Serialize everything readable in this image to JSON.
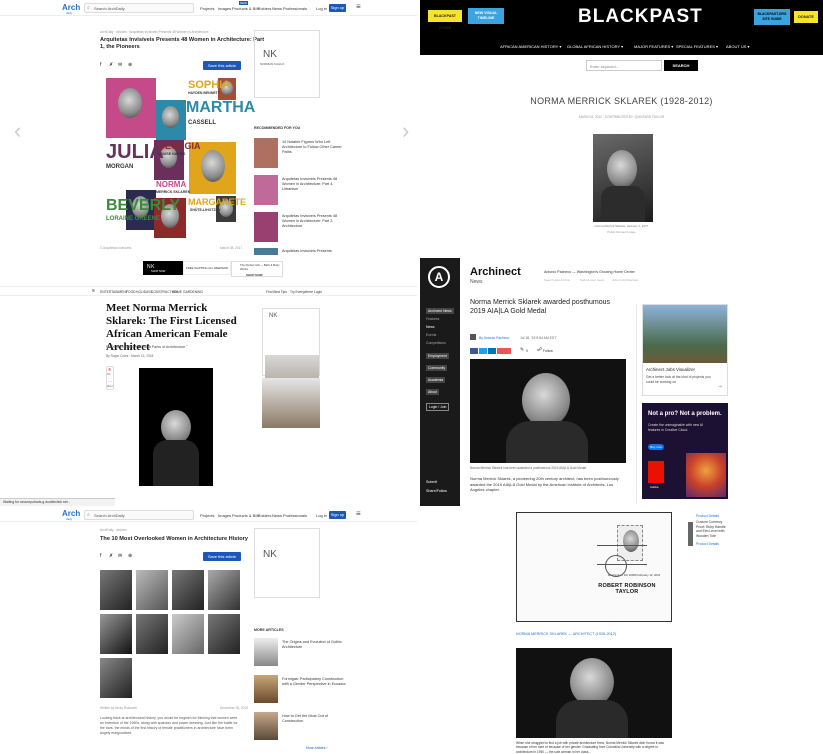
{
  "p1": {
    "logo": "Arch",
    "logo_sub": "daily",
    "search_placeholder": "Search ArchDaily",
    "nav": [
      "Projects",
      "Images",
      "Products & BIM",
      "Folders",
      "News",
      "Professionals"
    ],
    "nav_badge": "NEW",
    "login": "Log in",
    "signup": "Sign up",
    "breadcrumb": "ArchDaily · Articles · Arquitetas Invisíveis Presents 48 Women in Architecture",
    "title": "Arquitetas Invisíveis Presents 48 Women in Architecture: Part 1, the Pioneers",
    "save_label": "Save this article",
    "names": [
      "SOPHIA",
      "HAYDEN BENNETT",
      "MARTHA",
      "CASSELL",
      "JULIA",
      "MORGAN",
      "GEORGIA",
      "LOUISE HARRIS",
      "NORMA",
      "MERRICK SKLAREK",
      "BEVERLY",
      "LORAINE GREENE",
      "MARGARETE",
      "SHÜTE-LIHOTZKY"
    ],
    "ad_brand": "NK",
    "ad_brand_sub": "NORMAN KAHLO",
    "recommended_heading": "RECOMMENDED FOR YOU",
    "recommended": [
      "10 Notable Figures Who Left Architecture to Follow Other Career Paths",
      "Arquitetas Invisíveis Presents 48 Women in Architecture: Part 4, Urbanism",
      "Arquitetas Invisíveis Presents 48 Women in Architecture: Part 2, Architecture",
      "Arquitetas Invisíveis Presents"
    ],
    "credit": "© Arquitetas Invisíveis",
    "date": "March 08, 2017"
  },
  "p2": {
    "store_btn": "BLACKPAST STORE",
    "timeline_btn": "NEW VISUAL TIMELINE",
    "logo": "BLACKPAST",
    "guide_btn": "BLACKPAST.ORG SITE GUIDE",
    "donate_btn": "DONATE",
    "nav": [
      "AFRICAN AMERICAN HISTORY ▾",
      "GLOBAL AFRICAN HISTORY ▾",
      "MAJOR FEATURES ▾",
      "SPECIAL FEATURES ▾",
      "ABOUT US ▾"
    ],
    "search_placeholder": "Enter keyword...",
    "search_btn": "SEARCH",
    "title": "NORMA MERRICK SKLAREK (1928-2012)",
    "meta": "MARCH 8, 2012 · CONTRIBUTED BY: QUINTARD TAYLOR",
    "caption": "Norma Merrick Sklarek, January 1, 1977",
    "caption2": "Public Domain Image"
  },
  "p3": {
    "ad_brand": "NK",
    "ad_text": "FREE SHIPPING ALL WEEKEND",
    "ad_cta": "SHOP NOW",
    "ad_right": "The Perfect Gift — Bath & Body Works",
    "ad_right_cta": "SHOP NOW",
    "nav": [
      "ENTERTAINMENT",
      "FOOD",
      "HOLIDAYS",
      "CONSTRUCTION",
      "HOME",
      "GARDENING"
    ],
    "nav_right": [
      "Find Best Tips",
      "Try Everywhere",
      "Login"
    ],
    "title": "Meet Norma Merrick Sklarek: The First Licensed African American Female Architect",
    "subtitle": "She's been called the \"Rosa Parks of Architecture.\"",
    "byline": "By Roger Coles · March 15, 2018",
    "share_labels": [
      "Pin",
      "More"
    ],
    "status": "Waiting for securepubads.g.doubleclick.net..."
  },
  "p4": {
    "logo": "Archinect",
    "logo_sub": "News",
    "top_links": [
      "Antonio Pacheco — Washington's Growing Home Center",
      "Search jobs & firms",
      "Submit your news",
      "Jobs in Architecture"
    ],
    "sidebar": [
      "Archinect News",
      "Features",
      "News",
      "Events",
      "Competitions",
      "Employment",
      "Community",
      "Academia",
      "About",
      "Login / Join"
    ],
    "sidebar_bottom": [
      "Submit",
      "Share/Follow"
    ],
    "title": "Norma Merrick Sklarek awarded posthumous 2019 AIA|LA Gold Medal",
    "author": "By Antonio Pacheco",
    "date": "Jul 18, '19 9:54 AM EST",
    "comments": "0",
    "follow": "Follow",
    "caption": "Norma Merrick Sklarek has been awarded a posthumous 2019 AIA|LA Gold Medal.",
    "body": "Norma Merrick Sklarek, a pioneering 20th century architect, has been posthumously awarded the 2019 AIA|LA Gold Medal by the American Institute of Architects, Los Angeles chapter.",
    "aia_link": "AIA|LA",
    "jobs_title": "Archinect Jobs Visualizer",
    "jobs_text": "Get a better look at the kind of projects you could be working on",
    "ad_title": "Not a pro? Not a problem.",
    "ad_text": "Create the unimaginable with new AI features in Creative Cloud.",
    "ad_btn": "Buy now",
    "ad_brand": "Adobe"
  },
  "p5": {
    "logo": "Arch",
    "logo_sub": "daily",
    "search_placeholder": "Search ArchDaily",
    "nav": [
      "Projects",
      "Images",
      "Products & BIM",
      "Folders",
      "News",
      "Professionals"
    ],
    "login": "Log in",
    "signup": "Sign up",
    "breadcrumb": "ArchDaily · Articles",
    "title": "The 10 Most Overlooked Women in Architecture History",
    "save_label": "Save this article",
    "more_heading": "MORE ARTICLES",
    "more": [
      "The Origins and Evolution of Gothic Architecture",
      "Formigas: Participatory Construction with a Gender Perspective in Ecuador",
      "How to Get the Most Out of Construction"
    ],
    "more_link": "More Articles ›",
    "credit": "Written by Nicky Rockwell",
    "date": "December 08, 2015",
    "body": "Looking back at architectural history, you would be forgiven for thinking that women were an invention of the 1960s, along with spandex and power dressing. Just like the battle for the bars, the minds of the first history of female practitioners in architecture have been largely marginalized."
  },
  "p6": {
    "stamp_name": "ROBERT ROBINSON TAYLOR",
    "stamp_postmark": "Washington, DC 20066 February 12, 2015",
    "link": "NORMA MERRICK SKLAREK — ARCHITECT (1926-2012)",
    "product_details": "Product Details",
    "product_title": "Custom Currency Proof: Ruby Handle and Elm Level with Wooden Tote",
    "product_details2": "Product Details",
    "body": "When she struggled to find a job with private architecture firms, Norma Merrick Sklarek didn't know it was because of her race or because of her gender. Graduating from Columbia University with a degree in architecture in 1950 — the sole woman in her class..."
  },
  "colors": {
    "archdaily_blue": "#1b58b8",
    "blackpast_yellow": "#f7e32a",
    "blackpast_blue": "#3aa3e0",
    "archinect_black": "#1a1a1a"
  }
}
